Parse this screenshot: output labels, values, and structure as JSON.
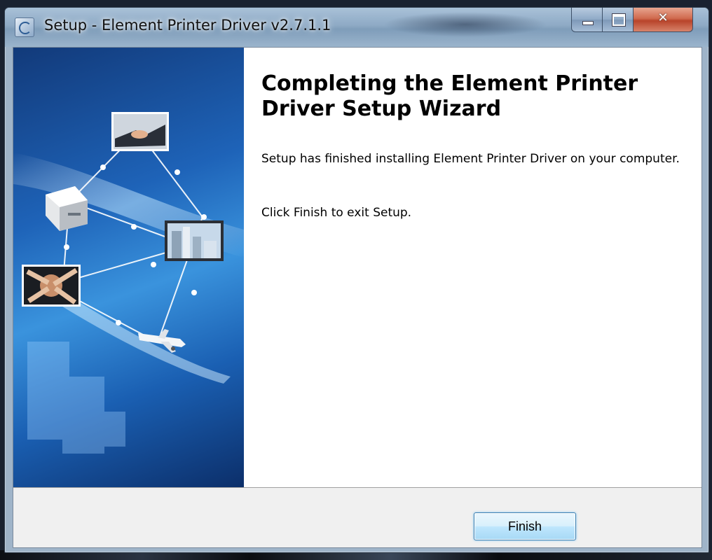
{
  "window": {
    "title": "Setup - Element Printer Driver v2.7.1.1",
    "controls": {
      "minimize": "minimize",
      "maximize": "maximize",
      "close": "close"
    }
  },
  "main": {
    "heading": "Completing the Element Printer Driver Setup Wizard",
    "paragraph_finished": "Setup has finished installing Element Printer Driver on your computer.",
    "paragraph_exit": "Click Finish to exit Setup."
  },
  "footer": {
    "finish_label": "Finish"
  },
  "colors": {
    "sidebar_blue": "#1e63b8",
    "button_border": "#3c7fb1",
    "close_red": "#c8513a"
  },
  "icons": [
    "setup-app-icon",
    "minimize-icon",
    "maximize-icon",
    "close-icon"
  ]
}
